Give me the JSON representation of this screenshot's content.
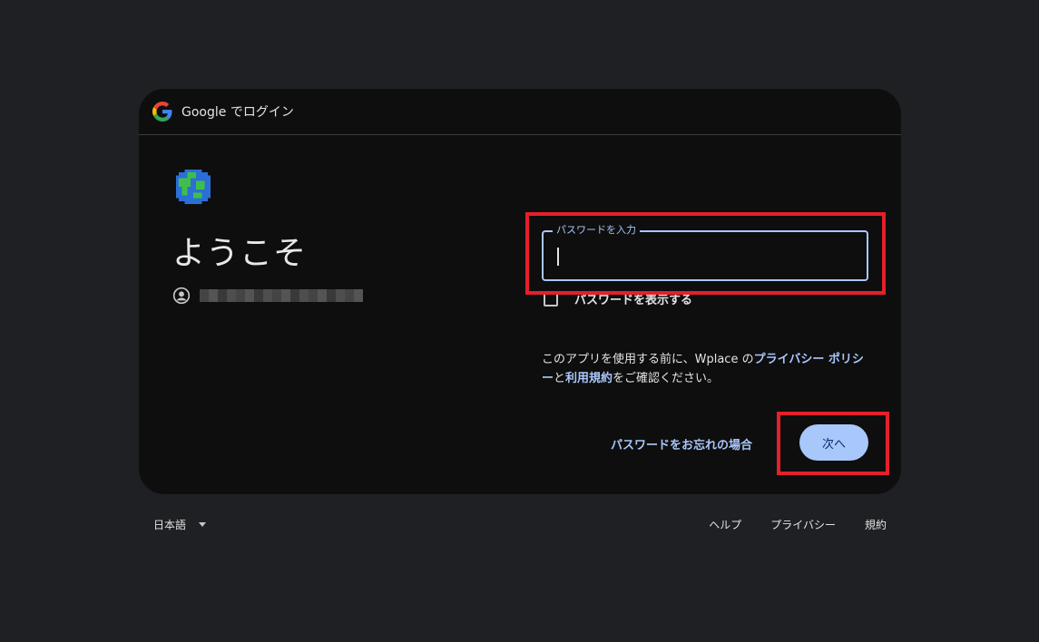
{
  "header": {
    "title": "Google でログイン"
  },
  "main": {
    "welcome": "ようこそ",
    "password_label": "パスワードを入力",
    "password_value": "",
    "show_password_label": "パスワードを表示する",
    "consent": {
      "prefix": "このアプリを使用する前に、Wplace の",
      "privacy_link": "プライバシー ポリシー",
      "middle": "と",
      "terms_link": "利用規約",
      "suffix": "をご確認ください。"
    },
    "forgot_password": "パスワードをお忘れの場合",
    "next_button": "次へ"
  },
  "footer": {
    "language": "日本語",
    "links": [
      "ヘルプ",
      "プライバシー",
      "規約"
    ]
  },
  "colors": {
    "accent": "#a8c7fa",
    "highlight": "#e5202a",
    "card_bg": "#0e0e0e",
    "page_bg": "#1f2023"
  },
  "icons": [
    "google-logo-icon",
    "earth-app-icon",
    "account-circle-icon",
    "checkbox-icon",
    "dropdown-caret-icon"
  ]
}
